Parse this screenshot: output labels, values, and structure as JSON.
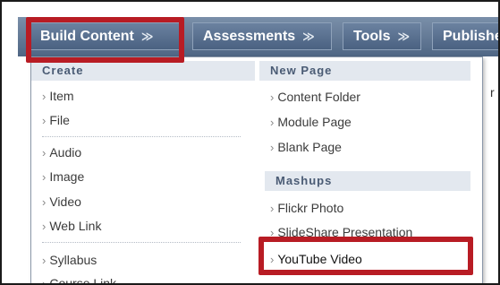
{
  "menubar": {
    "build_content": "Build Content",
    "assessments": "Assessments",
    "tools": "Tools",
    "publisher": "Publisher",
    "chevron": "≫"
  },
  "dropdown": {
    "create": {
      "heading": "Create",
      "items": [
        "Item",
        "File",
        "Audio",
        "Image",
        "Video",
        "Web Link",
        "Syllabus",
        "Course Link"
      ]
    },
    "new_page": {
      "heading": "New Page",
      "items": [
        "Content Folder",
        "Module Page",
        "Blank Page"
      ]
    },
    "mashups": {
      "heading": "Mashups",
      "items": [
        "Flickr Photo",
        "SlideShare Presentation",
        "YouTube Video"
      ]
    },
    "arrow": "›"
  },
  "edge_text": "r",
  "colors": {
    "highlight": "#b81c24",
    "menubar": "#5a708f",
    "section_header_bg": "#e3e8ef"
  }
}
